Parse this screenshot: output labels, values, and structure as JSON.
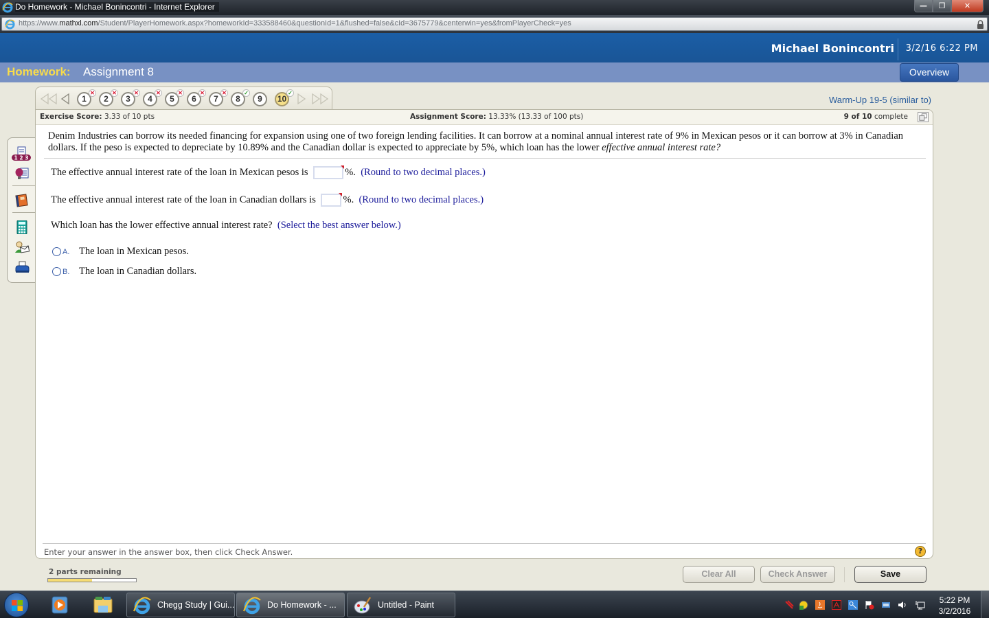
{
  "window": {
    "title": "Do Homework - Michael Bonincontri - Internet Explorer",
    "controls": {
      "minimize": "—",
      "restore": "❐",
      "close": "✕"
    }
  },
  "address_bar": {
    "scheme": "https://www.",
    "domain": "mathxl.com",
    "path": "/Student/PlayerHomework.aspx?homeworkId=333588460&questionId=1&flushed=false&cId=3675779&centerwin=yes&fromPlayerCheck=yes"
  },
  "header": {
    "user_name": "Michael Bonincontri",
    "datetime": "3/2/16 6:22 PM"
  },
  "subheader": {
    "homework_label": "Homework:",
    "assignment_name": "Assignment 8",
    "overview_button": "Overview"
  },
  "question_nav": {
    "questions": [
      {
        "number": "1",
        "status": "incorrect",
        "status_glyph": "✕"
      },
      {
        "number": "2",
        "status": "incorrect",
        "status_glyph": "✕"
      },
      {
        "number": "3",
        "status": "incorrect",
        "status_glyph": "✕"
      },
      {
        "number": "4",
        "status": "incorrect",
        "status_glyph": "✕"
      },
      {
        "number": "5",
        "status": "incorrect",
        "status_glyph": "✕"
      },
      {
        "number": "6",
        "status": "incorrect",
        "status_glyph": "✕"
      },
      {
        "number": "7",
        "status": "incorrect",
        "status_glyph": "✕"
      },
      {
        "number": "8",
        "status": "correct",
        "status_glyph": "✓"
      },
      {
        "number": "9",
        "status": "unanswered",
        "status_glyph": ""
      },
      {
        "number": "10",
        "status": "partial",
        "status_glyph": "✓"
      }
    ],
    "current_question": "10",
    "similar_to_link": "Warm-Up 19-5 (similar to)"
  },
  "scores": {
    "exercise_label": "Exercise Score:",
    "exercise_value": "3.33 of 10 pts",
    "assignment_label": "Assignment Score:",
    "assignment_value": "13.33% (13.33 of 100 pts)",
    "complete_count": "9 of 10",
    "complete_label": "complete"
  },
  "question": {
    "prompt_main": "Denim Industries can borrow its needed financing for expansion using one of two foreign lending facilities.  It can borrow at a nominal annual interest rate of 9% in Mexican pesos or it can borrow at 3% in Canadian dollars.  If the peso is expected to depreciate by 10.89% and the Canadian dollar is expected to appreciate by 5%, which loan has the lower ",
    "prompt_emphasis": "effective annual interest rate?",
    "part1": {
      "text": "The effective annual interest rate of the loan in Mexican pesos is",
      "value": "",
      "suffix": "%.",
      "hint": "(Round to two decimal places.)"
    },
    "part2": {
      "text": "The effective annual interest rate of the loan in Canadian dollars is",
      "value": "",
      "suffix": "%.",
      "hint": "(Round to two decimal places.)"
    },
    "part3": {
      "text": "Which loan has the lower effective annual interest rate?",
      "hint": "(Select the best answer below.)"
    },
    "options": [
      {
        "letter": "A.",
        "text": "The loan in Mexican pesos.",
        "selected": false
      },
      {
        "letter": "B.",
        "text": "The loan in Canadian dollars.",
        "selected": false
      }
    ],
    "instruction": "Enter your answer in the answer box, then click Check Answer.",
    "help_glyph": "?"
  },
  "side_tools": [
    {
      "icon": "question-list-icon",
      "badge": "1 2 3"
    },
    {
      "icon": "help-me-solve-icon"
    },
    {
      "icon": "textbook-icon"
    },
    {
      "icon": "calculator-icon"
    },
    {
      "icon": "ask-instructor-icon"
    },
    {
      "icon": "print-icon"
    }
  ],
  "footer": {
    "parts_remaining": "2 parts remaining",
    "progress_fraction": 0.5,
    "clear_all": "Clear All",
    "check_answer": "Check Answer",
    "save": "Save"
  },
  "taskbar": {
    "tasks": [
      {
        "label": "Chegg Study | Gui...",
        "icon": "internet-explorer-icon",
        "active": false
      },
      {
        "label": "Do Homework - ...",
        "icon": "internet-explorer-icon",
        "active": true
      },
      {
        "label": "Untitled - Paint",
        "icon": "paint-icon",
        "active": false
      }
    ],
    "clock_time": "5:22 PM",
    "clock_date": "3/2/2016"
  },
  "colors": {
    "header_blue": "#1b5ea6",
    "subheader_blue": "#7891c3",
    "homework_yellow": "#f9dc4a",
    "hint_blue": "#1a1a9a",
    "incorrect_red": "#d8102a",
    "correct_green": "#2a9a27"
  }
}
